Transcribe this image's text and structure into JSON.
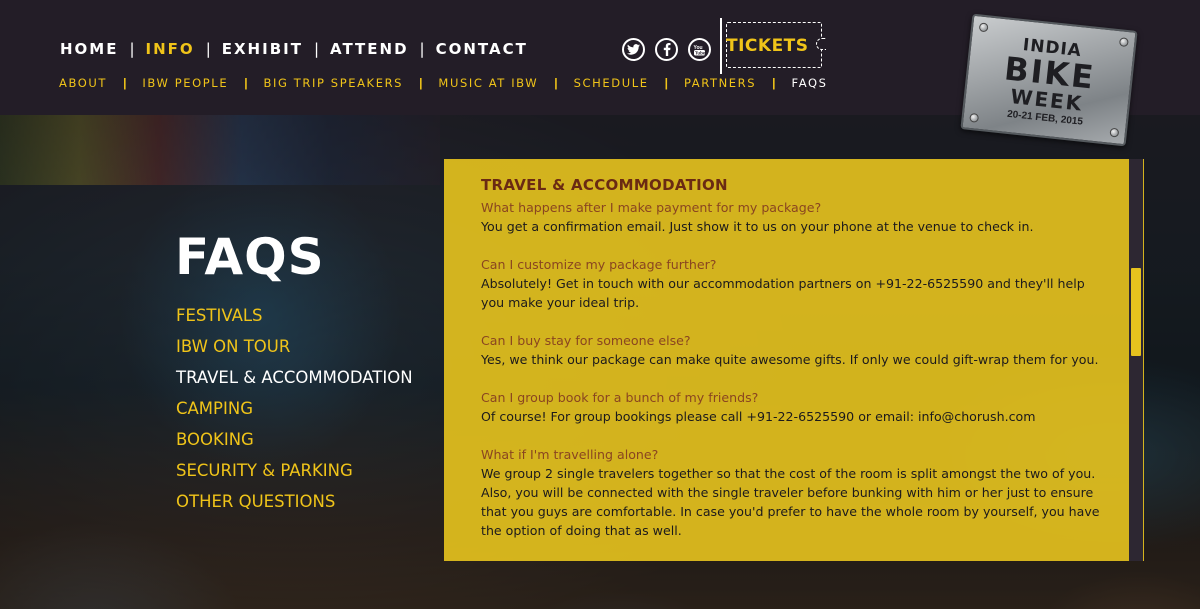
{
  "header": {
    "main_nav": [
      {
        "label": "HOME",
        "active": false
      },
      {
        "label": "INFO",
        "active": true
      },
      {
        "label": "EXHIBIT",
        "active": false
      },
      {
        "label": "ATTEND",
        "active": false
      },
      {
        "label": "CONTACT",
        "active": false
      }
    ],
    "separator": "|",
    "social": [
      "twitter-icon",
      "facebook-icon",
      "youtube-icon"
    ],
    "tickets_label": "TICKETS",
    "sub_nav": [
      {
        "label": "ABOUT",
        "active": false
      },
      {
        "label": "IBW PEOPLE",
        "active": false
      },
      {
        "label": "BIG TRIP SPEAKERS",
        "active": false
      },
      {
        "label": "MUSIC AT IBW",
        "active": false
      },
      {
        "label": "SCHEDULE",
        "active": false
      },
      {
        "label": "PARTNERS",
        "active": false
      },
      {
        "label": "FAQS",
        "active": true
      }
    ]
  },
  "logo": {
    "line1": "INDIA",
    "line2": "BIKE",
    "line3": "WEEK",
    "dates": "20-21 FEB, 2015"
  },
  "sidebar": {
    "title": "FAQS",
    "items": [
      {
        "label": "FESTIVALS",
        "active": false
      },
      {
        "label": "IBW ON TOUR",
        "active": false
      },
      {
        "label": "TRAVEL & ACCOMMODATION",
        "active": true
      },
      {
        "label": "CAMPING",
        "active": false
      },
      {
        "label": "BOOKING",
        "active": false
      },
      {
        "label": "SECURITY & PARKING",
        "active": false
      },
      {
        "label": "OTHER QUESTIONS",
        "active": false
      }
    ]
  },
  "content": {
    "heading": "TRAVEL & ACCOMMODATION",
    "faqs": [
      {
        "q": "What happens after I make payment for my package?",
        "a": "You get a confirmation email. Just show it to us on your phone at the venue to check in."
      },
      {
        "q": "Can I customize my package further?",
        "a": "Absolutely! Get in touch with our accommodation partners on +91-22-6525590 and they'll help you make your ideal trip."
      },
      {
        "q": "Can I buy stay for someone else?",
        "a": "Yes, we think our package can make quite awesome gifts. If only we could gift-wrap them for you."
      },
      {
        "q": "Can I group book for a bunch of my friends?",
        "a": "Of course! For group bookings please call +91-22-6525590 or email: info@chorush.com"
      },
      {
        "q": "What if I'm travelling alone?",
        "a": "We group 2 single travelers together so that the cost of the room is split amongst the two of you. Also, you will be connected with the single traveler before bunking with him or her just to ensure that you guys are comfortable. In case you'd prefer to have the whole room by yourself, you have the option of doing that as well."
      }
    ]
  },
  "colors": {
    "accent": "#f0c419",
    "header_bg": "#231d27",
    "panel_bg": "#e8c41e",
    "heading": "#6a2a13",
    "question": "#8a4520"
  }
}
